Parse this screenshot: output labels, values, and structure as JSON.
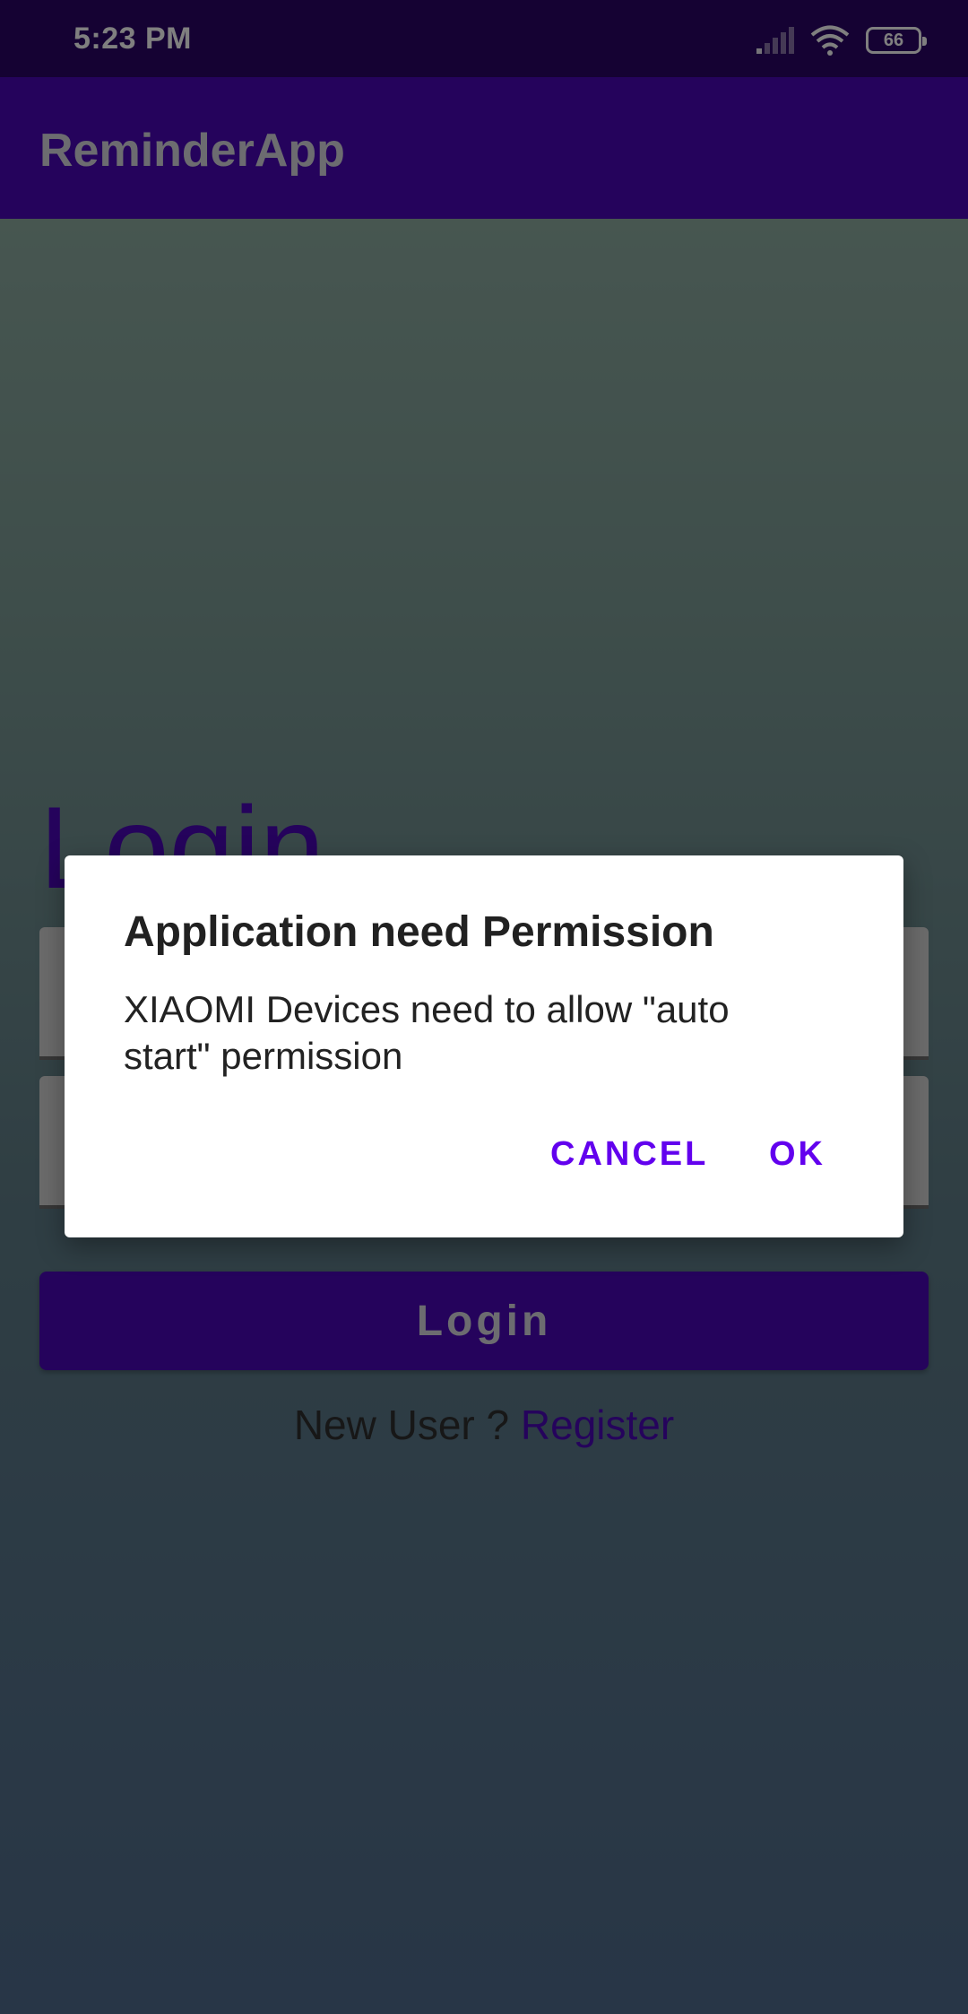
{
  "status_bar": {
    "time": "5:23 PM",
    "battery_level": "66",
    "icons": [
      "signal-icon",
      "wifi-icon",
      "battery-icon"
    ]
  },
  "app_bar": {
    "title": "ReminderApp"
  },
  "login": {
    "heading": "Login",
    "button_label": "Login",
    "new_user_text": "New User ? ",
    "register_link": "Register"
  },
  "dialog": {
    "title": "Application need Permission",
    "message": "XIAOMI Devices need to allow \"auto start\" permission",
    "cancel_label": "CANCEL",
    "ok_label": "OK"
  },
  "colors": {
    "primary": "#4b07b8",
    "status_bar": "#2a0466",
    "dialog_button": "#6200ee"
  }
}
